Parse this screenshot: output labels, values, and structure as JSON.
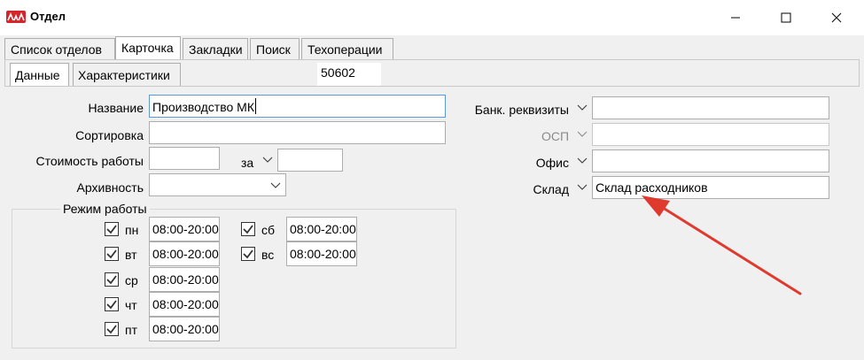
{
  "window": {
    "title": "Отдел"
  },
  "tabs": [
    "Список отделов",
    "Карточка",
    "Закладки",
    "Поиск",
    "Техоперации"
  ],
  "subtabs": [
    "Данные",
    "Характеристики"
  ],
  "record_number": "50602",
  "form": {
    "name_label": "Название",
    "name_value": "Производство МК",
    "sort_label": "Сортировка",
    "sort_value": "",
    "cost_label": "Стоимость работы",
    "cost_value": "",
    "per_label": "за",
    "per_value": "",
    "archive_label": "Архивность",
    "archive_value": ""
  },
  "schedule": {
    "title": "Режим работы",
    "days": [
      {
        "label": "пн",
        "time": "08:00-20:00",
        "checked": true
      },
      {
        "label": "вт",
        "time": "08:00-20:00",
        "checked": true
      },
      {
        "label": "ср",
        "time": "08:00-20:00",
        "checked": true
      },
      {
        "label": "чт",
        "time": "08:00-20:00",
        "checked": true
      },
      {
        "label": "пт",
        "time": "08:00-20:00",
        "checked": true
      },
      {
        "label": "сб",
        "time": "08:00-20:00",
        "checked": true
      },
      {
        "label": "вс",
        "time": "08:00-20:00",
        "checked": true
      }
    ]
  },
  "right": {
    "bank_label": "Банк. реквизиты",
    "bank_value": "",
    "osp_label": "ОСП",
    "osp_value": "",
    "office_label": "Офис",
    "office_value": "",
    "warehouse_label": "Склад",
    "warehouse_value": "Склад расходников"
  },
  "colors": {
    "arrow": "#e03a2f",
    "focus_border": "#5a9bd5",
    "brand": "#d4252a"
  }
}
